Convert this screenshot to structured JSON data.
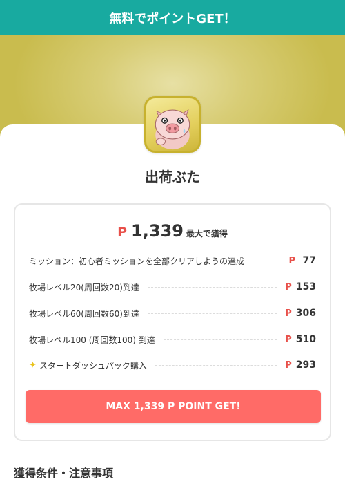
{
  "header": {
    "title": "無料でポイントGET！"
  },
  "app": {
    "name": "出荷ぶた",
    "icon": "pig-face-icon"
  },
  "reward": {
    "currency_mark": "P",
    "total": "1,339",
    "total_suffix": "最大で獲得",
    "items": [
      {
        "label": "ミッション：初心者ミッションを全部クリアしようの達成",
        "mark": "P",
        "points": "77"
      },
      {
        "label": "牧場レベル20(周回数20)到達",
        "mark": "P",
        "points": "153"
      },
      {
        "label": "牧場レベル60(周回数60)到達",
        "mark": "P",
        "points": "306"
      },
      {
        "label": "牧場レベル100 (周回数100) 到達",
        "mark": "P",
        "points": "510"
      },
      {
        "label": "スタートダッシュパック購入",
        "mark": "P",
        "points": "293",
        "icon": "sparkle-icon"
      }
    ],
    "button_label": "MAX 1,339 P POINT GET!"
  },
  "conditions": {
    "heading": "獲得条件・注意事項"
  },
  "colors": {
    "header_bg": "#18aaa0",
    "accent_red": "#e8504a",
    "button_bg": "#ff6b67",
    "hero_bg": "#d8cd76"
  }
}
